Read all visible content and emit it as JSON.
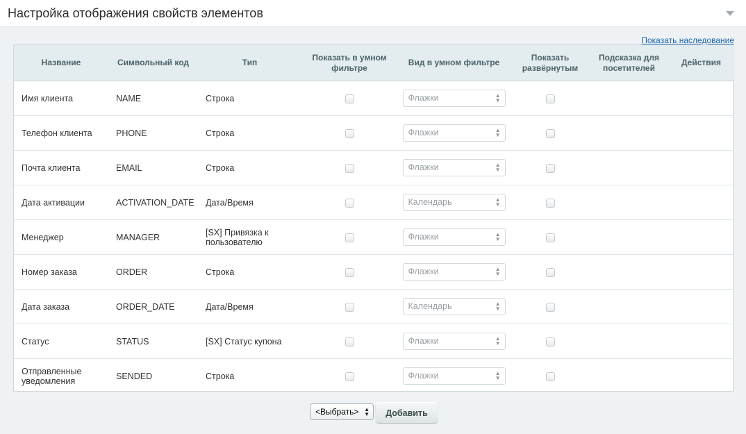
{
  "header": {
    "title": "Настройка отображения свойств элементов"
  },
  "inherit_link": "Показать наследование",
  "table": {
    "columns": [
      "Название",
      "Символьный код",
      "Тип",
      "Показать в умном фильтре",
      "Вид в умном фильтре",
      "Показать развёрнутым",
      "Подсказка для посетителей",
      "Действия"
    ],
    "rows": [
      {
        "name": "Имя клиента",
        "code": "NAME",
        "type": "Строка",
        "filter_view": "Флажки",
        "show_in_filter": false,
        "expanded": false
      },
      {
        "name": "Телефон клиента",
        "code": "PHONE",
        "type": "Строка",
        "filter_view": "Флажки",
        "show_in_filter": false,
        "expanded": false
      },
      {
        "name": "Почта клиента",
        "code": "EMAIL",
        "type": "Строка",
        "filter_view": "Флажки",
        "show_in_filter": false,
        "expanded": false
      },
      {
        "name": "Дата активации",
        "code": "ACTIVATION_DATE",
        "type": "Дата/Время",
        "filter_view": "Календарь",
        "show_in_filter": false,
        "expanded": false
      },
      {
        "name": "Менеджер",
        "code": "MANAGER",
        "type": "[SX] Привязка к пользователю",
        "filter_view": "Флажки",
        "show_in_filter": false,
        "expanded": false
      },
      {
        "name": "Номер заказа",
        "code": "ORDER",
        "type": "Строка",
        "filter_view": "Флажки",
        "show_in_filter": false,
        "expanded": false
      },
      {
        "name": "Дата заказа",
        "code": "ORDER_DATE",
        "type": "Дата/Время",
        "filter_view": "Календарь",
        "show_in_filter": false,
        "expanded": false
      },
      {
        "name": "Статус",
        "code": "STATUS",
        "type": "[SX] Статус купона",
        "filter_view": "Флажки",
        "show_in_filter": false,
        "expanded": false
      },
      {
        "name": "Отправленные уведомления",
        "code": "SENDED",
        "type": "Строка",
        "filter_view": "Флажки",
        "show_in_filter": false,
        "expanded": false
      }
    ]
  },
  "footer": {
    "select_value": "<Выбрать>",
    "add_label": "Добавить"
  },
  "icons": {
    "collapse": "triangle-down-icon",
    "select_arrows": "updown-arrows-icon"
  }
}
